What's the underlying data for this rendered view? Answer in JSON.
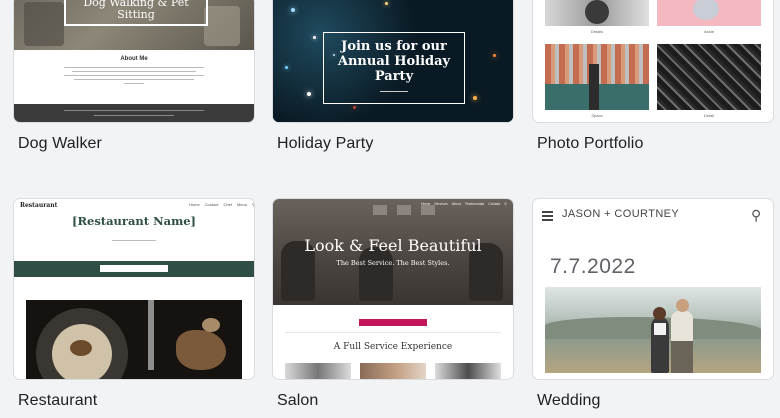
{
  "templates": [
    {
      "label": "Dog Walker",
      "hero_title": "Dog Walking & Pet Sitting",
      "about_heading": "About Me"
    },
    {
      "label": "Holiday Party",
      "hero_title": "Join us for our Annual Holiday Party"
    },
    {
      "label": "Photo Portfolio",
      "captions": [
        "Details",
        "Aside",
        "Space",
        "Detail"
      ]
    },
    {
      "label": "Restaurant",
      "brand": "Restaurant",
      "nav": [
        "Home",
        "Contact",
        "Chef",
        "Menu"
      ],
      "hero_title": "[Restaurant Name]"
    },
    {
      "label": "Salon",
      "nav": [
        "Home",
        "Services",
        "About",
        "Testimonials",
        "Contact"
      ],
      "hero_title": "Look & Feel Beautiful",
      "hero_subtitle": "The Best Service. The Best Styles.",
      "section_title": "A Full Service Experience"
    },
    {
      "label": "Wedding",
      "names": "JASON + COURTNEY",
      "date": "7.7.2022"
    }
  ]
}
